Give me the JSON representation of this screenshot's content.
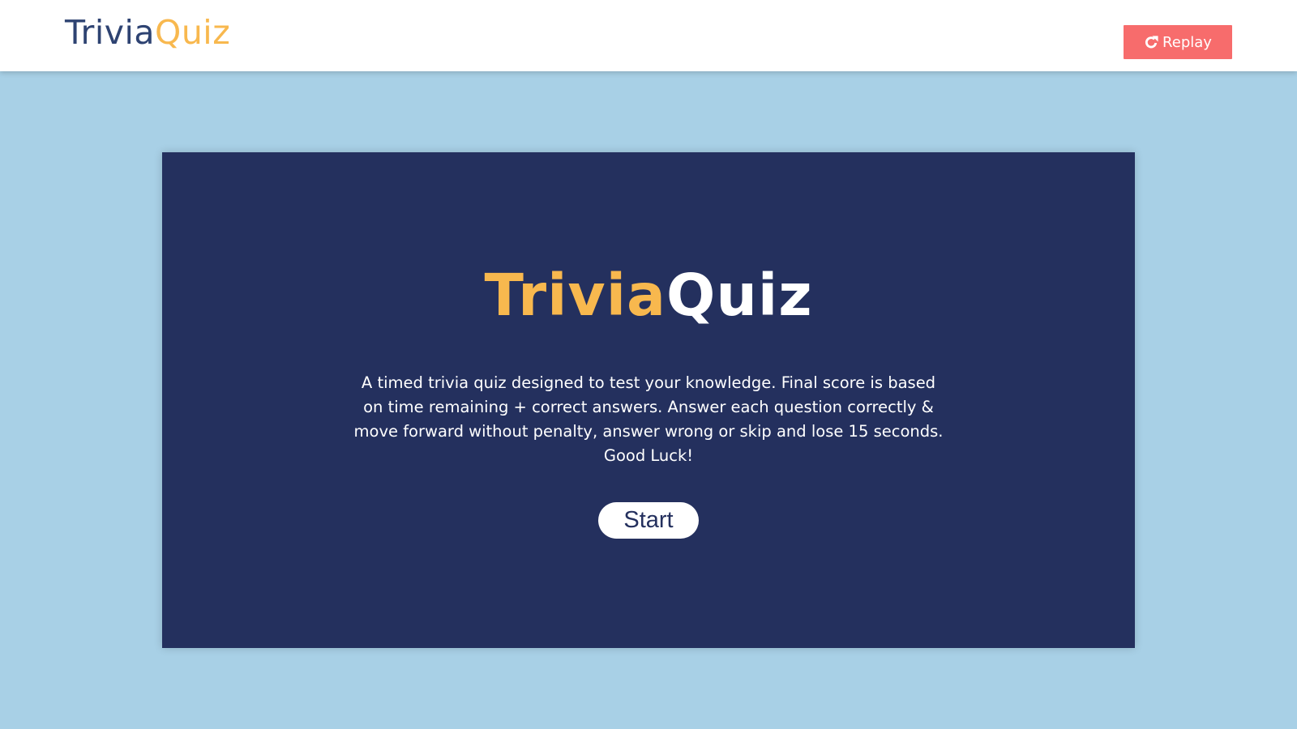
{
  "header": {
    "logo": {
      "part1": "Trivia",
      "part2": "Quiz"
    },
    "replay_button": {
      "label": "Replay",
      "icon": "redo-icon"
    }
  },
  "intro": {
    "title": {
      "part1": "Trivia",
      "part2": "Quiz"
    },
    "description": "A timed trivia quiz designed to test your knowledge. Final score is based on time remaining + correct answers. Answer each question correctly & move forward without penalty, answer wrong or skip and lose 15 seconds. Good Luck!",
    "start_button": "Start"
  },
  "colors": {
    "page_background": "#a8d0e6",
    "header_background": "#ffffff",
    "card_background": "#24305e",
    "accent_yellow": "#f8b84e",
    "replay_red": "#f76c6c",
    "logo_blue": "#2e4372"
  }
}
